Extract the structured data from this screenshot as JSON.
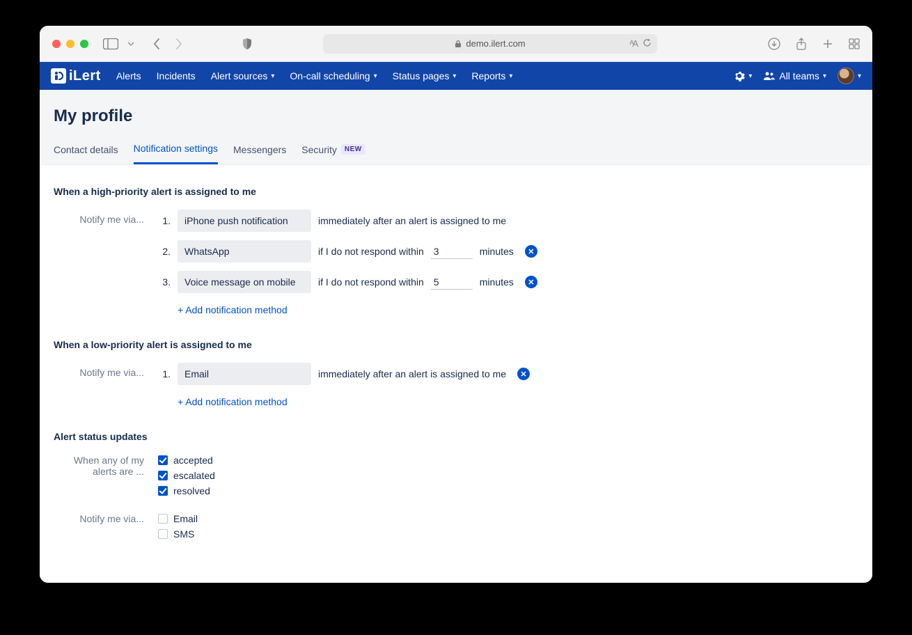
{
  "browser": {
    "url": "demo.ilert.com"
  },
  "brand": {
    "name": "iLert"
  },
  "nav": {
    "items": [
      {
        "label": "Alerts",
        "dropdown": false
      },
      {
        "label": "Incidents",
        "dropdown": false
      },
      {
        "label": "Alert sources",
        "dropdown": true
      },
      {
        "label": "On-call scheduling",
        "dropdown": true
      },
      {
        "label": "Status pages",
        "dropdown": true
      },
      {
        "label": "Reports",
        "dropdown": true
      }
    ],
    "team_label": "All teams"
  },
  "page": {
    "title": "My profile",
    "tabs": [
      {
        "label": "Contact details",
        "active": false
      },
      {
        "label": "Notification settings",
        "active": true
      },
      {
        "label": "Messengers",
        "active": false
      },
      {
        "label": "Security",
        "active": false,
        "badge": "NEW"
      }
    ]
  },
  "sections": {
    "high": {
      "title": "When a high-priority alert is assigned to me",
      "label": "Notify me via...",
      "rules": [
        {
          "num": "1.",
          "method": "iPhone push notification",
          "immediate": true,
          "text_immediate": "immediately after an alert is assigned to me"
        },
        {
          "num": "2.",
          "method": "WhatsApp",
          "immediate": false,
          "text_before": "if I do not respond within",
          "minutes": "3",
          "text_after": "minutes"
        },
        {
          "num": "3.",
          "method": "Voice message on mobile",
          "immediate": false,
          "text_before": "if I do not respond within",
          "minutes": "5",
          "text_after": "minutes"
        }
      ],
      "add_label": "+ Add notification method"
    },
    "low": {
      "title": "When a low-priority alert is assigned to me",
      "label": "Notify me via...",
      "rules": [
        {
          "num": "1.",
          "method": "Email",
          "immediate": true,
          "text_immediate": "immediately after an alert is assigned to me"
        }
      ],
      "add_label": "+ Add notification method"
    },
    "status": {
      "title": "Alert status updates",
      "when_label": "When any of my alerts are ...",
      "when_options": [
        {
          "label": "accepted",
          "checked": true
        },
        {
          "label": "escalated",
          "checked": true
        },
        {
          "label": "resolved",
          "checked": true
        }
      ],
      "notify_label": "Notify me via...",
      "notify_options": [
        {
          "label": "Email",
          "checked": false
        },
        {
          "label": "SMS",
          "checked": false
        }
      ]
    }
  }
}
